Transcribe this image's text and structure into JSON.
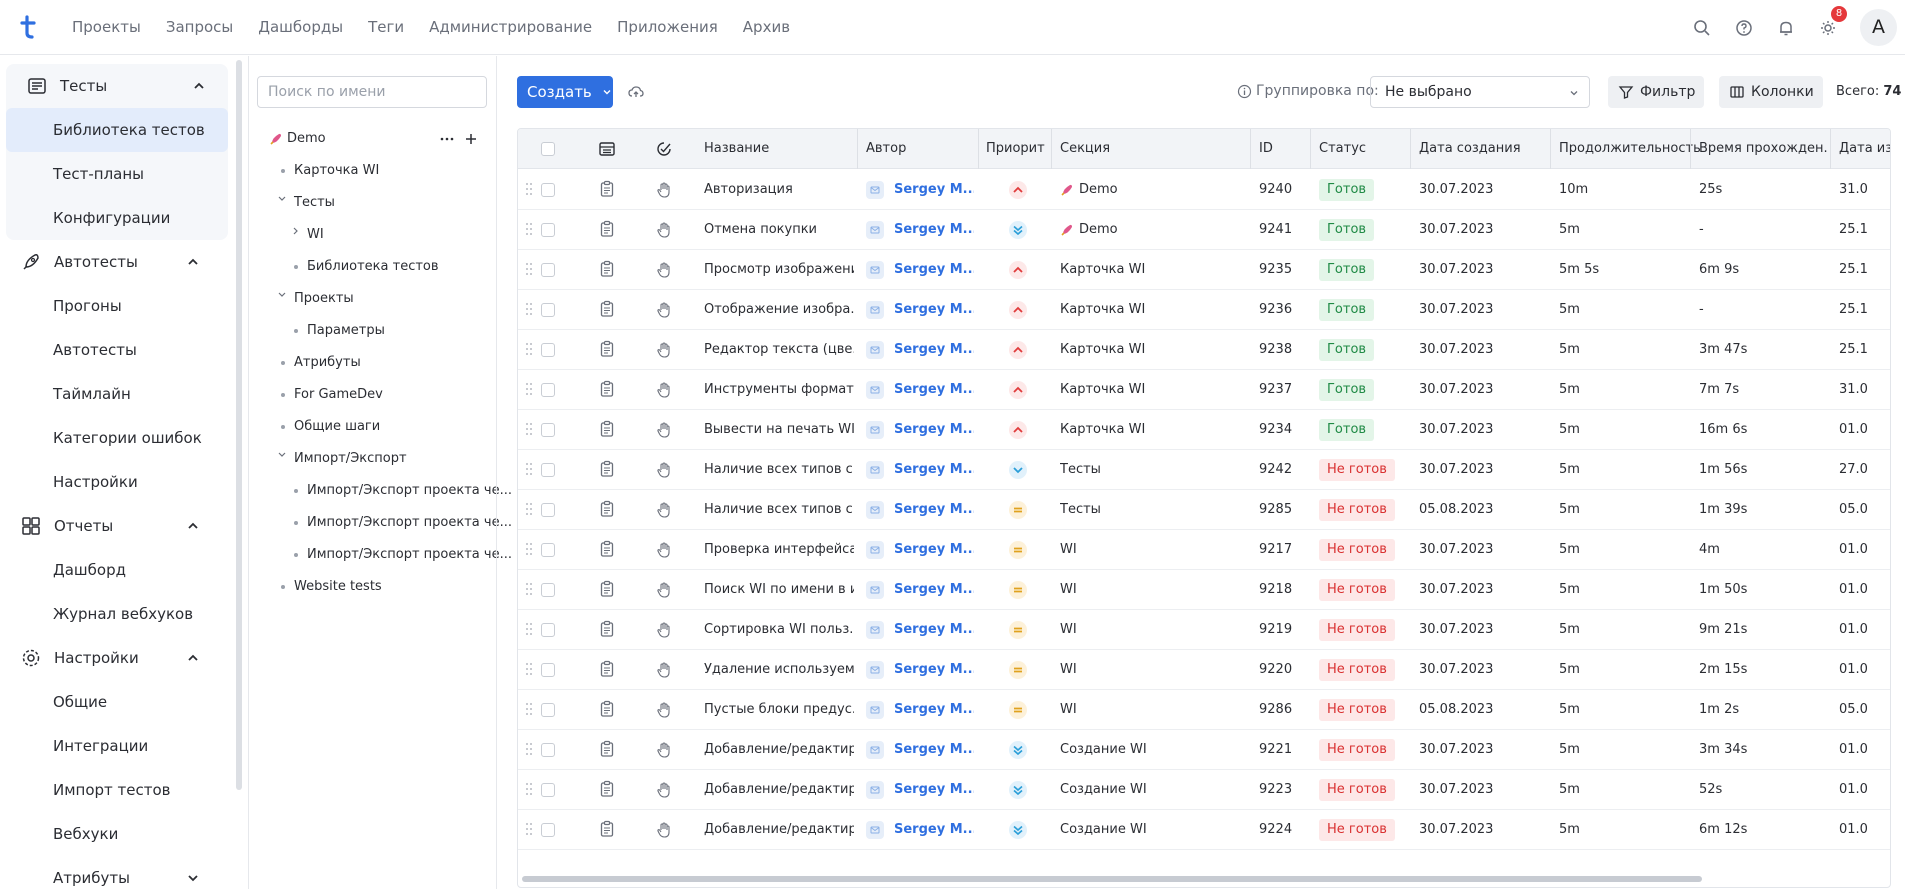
{
  "topnav": {
    "items": [
      "Проекты",
      "Запросы",
      "Дашборды",
      "Теги",
      "Администрирование",
      "Приложения",
      "Архив"
    ],
    "notification_count": "8",
    "avatar_letter": "A"
  },
  "sidebar": {
    "tests": {
      "title": "Тесты",
      "items": [
        "Библиотека тестов",
        "Тест-планы",
        "Конфигурации"
      ]
    },
    "autotests": {
      "title": "Автотесты",
      "items": [
        "Прогоны",
        "Автотесты",
        "Таймлайн",
        "Категории ошибок",
        "Настройки"
      ]
    },
    "reports": {
      "title": "Отчеты",
      "items": [
        "Дашборд",
        "Журнал вебхуков"
      ]
    },
    "settings": {
      "title": "Настройки",
      "items": [
        "Общие",
        "Интеграции",
        "Импорт тестов",
        "Вебхуки",
        "Атрибуты"
      ]
    }
  },
  "tree": {
    "search_placeholder": "Поиск по имени",
    "root": "Demo",
    "nodes": [
      "Карточка WI",
      "Тесты",
      "WI",
      "Библиотека тестов",
      "Проекты",
      "Параметры",
      "Атрибуты",
      "For GameDev",
      "Общие шаги",
      "Импорт/Экспорт",
      "Импорт/Экспорт проекта че...",
      "Импорт/Экспорт проекта че...",
      "Импорт/Экспорт проекта че...",
      "Website tests"
    ]
  },
  "toolbar": {
    "create_label": "Создать",
    "group_label": "Группировка по:",
    "group_value": "Не выбрано",
    "filter_label": "Фильтр",
    "columns_label": "Колонки",
    "total_label": "Всего:",
    "total_value": "74"
  },
  "table": {
    "headers": [
      "Название",
      "Автор",
      "Приорит...",
      "Секция",
      "ID",
      "Статус",
      "Дата создания",
      "Продолжительность",
      "Время прохожден...",
      "Дата из"
    ],
    "rows": [
      {
        "name": "Авторизация",
        "author": "Sergey M...",
        "priority": "high",
        "section": "Demo",
        "section_rocket": true,
        "id": "9240",
        "status": "Готов",
        "status_kind": "ready",
        "created": "30.07.2023",
        "duration": "10m",
        "pass_time": "25s",
        "changed": "31.0"
      },
      {
        "name": "Отмена покупки",
        "author": "Sergey M...",
        "priority": "lowest",
        "section": "Demo",
        "section_rocket": true,
        "id": "9241",
        "status": "Готов",
        "status_kind": "ready",
        "created": "30.07.2023",
        "duration": "5m",
        "pass_time": "-",
        "changed": "25.1"
      },
      {
        "name": "Просмотр изображения",
        "author": "Sergey M...",
        "priority": "high",
        "section": "Карточка WI",
        "section_rocket": false,
        "id": "9235",
        "status": "Готов",
        "status_kind": "ready",
        "created": "30.07.2023",
        "duration": "5m 5s",
        "pass_time": "6m 9s",
        "changed": "25.1"
      },
      {
        "name": "Отображение изобра...",
        "author": "Sergey M...",
        "priority": "high",
        "section": "Карточка WI",
        "section_rocket": false,
        "id": "9236",
        "status": "Готов",
        "status_kind": "ready",
        "created": "30.07.2023",
        "duration": "5m",
        "pass_time": "-",
        "changed": "25.1"
      },
      {
        "name": "Редактор текста (цве...",
        "author": "Sergey M...",
        "priority": "high",
        "section": "Карточка WI",
        "section_rocket": false,
        "id": "9238",
        "status": "Готов",
        "status_kind": "ready",
        "created": "30.07.2023",
        "duration": "5m",
        "pass_time": "3m 47s",
        "changed": "25.1"
      },
      {
        "name": "Инструменты формат...",
        "author": "Sergey M...",
        "priority": "high",
        "section": "Карточка WI",
        "section_rocket": false,
        "id": "9237",
        "status": "Готов",
        "status_kind": "ready",
        "created": "30.07.2023",
        "duration": "5m",
        "pass_time": "7m 7s",
        "changed": "31.0"
      },
      {
        "name": "Вывести на печать WI ...",
        "author": "Sergey M...",
        "priority": "high",
        "section": "Карточка WI",
        "section_rocket": false,
        "id": "9234",
        "status": "Готов",
        "status_kind": "ready",
        "created": "30.07.2023",
        "duration": "5m",
        "pass_time": "16m 6s",
        "changed": "01.0"
      },
      {
        "name": "Наличие всех типов с...",
        "author": "Sergey M...",
        "priority": "low",
        "section": "Тесты",
        "section_rocket": false,
        "id": "9242",
        "status": "Не готов",
        "status_kind": "notready",
        "created": "30.07.2023",
        "duration": "5m",
        "pass_time": "1m 56s",
        "changed": "27.0"
      },
      {
        "name": "Наличие всех типов с...",
        "author": "Sergey M...",
        "priority": "medium",
        "section": "Тесты",
        "section_rocket": false,
        "id": "9285",
        "status": "Не готов",
        "status_kind": "notready",
        "created": "05.08.2023",
        "duration": "5m",
        "pass_time": "1m 39s",
        "changed": "05.0"
      },
      {
        "name": "Проверка интерфейса...",
        "author": "Sergey M...",
        "priority": "medium",
        "section": "WI",
        "section_rocket": false,
        "id": "9217",
        "status": "Не готов",
        "status_kind": "notready",
        "created": "30.07.2023",
        "duration": "5m",
        "pass_time": "4m",
        "changed": "01.0"
      },
      {
        "name": "Поиск WI по имени в и...",
        "author": "Sergey M...",
        "priority": "medium",
        "section": "WI",
        "section_rocket": false,
        "id": "9218",
        "status": "Не готов",
        "status_kind": "notready",
        "created": "30.07.2023",
        "duration": "5m",
        "pass_time": "1m 50s",
        "changed": "01.0"
      },
      {
        "name": "Сортировка WI польз...",
        "author": "Sergey M...",
        "priority": "medium",
        "section": "WI",
        "section_rocket": false,
        "id": "9219",
        "status": "Не готов",
        "status_kind": "notready",
        "created": "30.07.2023",
        "duration": "5m",
        "pass_time": "9m 21s",
        "changed": "01.0"
      },
      {
        "name": "Удаление используем...",
        "author": "Sergey M...",
        "priority": "medium",
        "section": "WI",
        "section_rocket": false,
        "id": "9220",
        "status": "Не готов",
        "status_kind": "notready",
        "created": "30.07.2023",
        "duration": "5m",
        "pass_time": "2m 15s",
        "changed": "01.0"
      },
      {
        "name": "Пустые блоки предус...",
        "author": "Sergey M...",
        "priority": "medium",
        "section": "WI",
        "section_rocket": false,
        "id": "9286",
        "status": "Не готов",
        "status_kind": "notready",
        "created": "05.08.2023",
        "duration": "5m",
        "pass_time": "1m 2s",
        "changed": "05.0"
      },
      {
        "name": "Добавление/редактир...",
        "author": "Sergey M...",
        "priority": "lowest",
        "section": "Создание WI",
        "section_rocket": false,
        "id": "9221",
        "status": "Не готов",
        "status_kind": "notready",
        "created": "30.07.2023",
        "duration": "5m",
        "pass_time": "3m 34s",
        "changed": "01.0"
      },
      {
        "name": "Добавление/редактир...",
        "author": "Sergey M...",
        "priority": "lowest",
        "section": "Создание WI",
        "section_rocket": false,
        "id": "9223",
        "status": "Не готов",
        "status_kind": "notready",
        "created": "30.07.2023",
        "duration": "5m",
        "pass_time": "52s",
        "changed": "01.0"
      },
      {
        "name": "Добавление/редактир...",
        "author": "Sergey M...",
        "priority": "lowest",
        "section": "Создание WI",
        "section_rocket": false,
        "id": "9224",
        "status": "Не готов",
        "status_kind": "notready",
        "created": "30.07.2023",
        "duration": "5m",
        "pass_time": "6m 12s",
        "changed": "01.0"
      }
    ]
  },
  "colors": {
    "accent": "#2f6fe0",
    "ready_bg": "#e3f5e8",
    "ready_fg": "#1f8a45",
    "notready_bg": "#fde8e8",
    "notready_fg": "#d93030",
    "prio_high": "#e03b3b",
    "prio_medium": "#e0a21f",
    "prio_low": "#2a9ed8",
    "prio_lowest": "#2a9ed8"
  }
}
